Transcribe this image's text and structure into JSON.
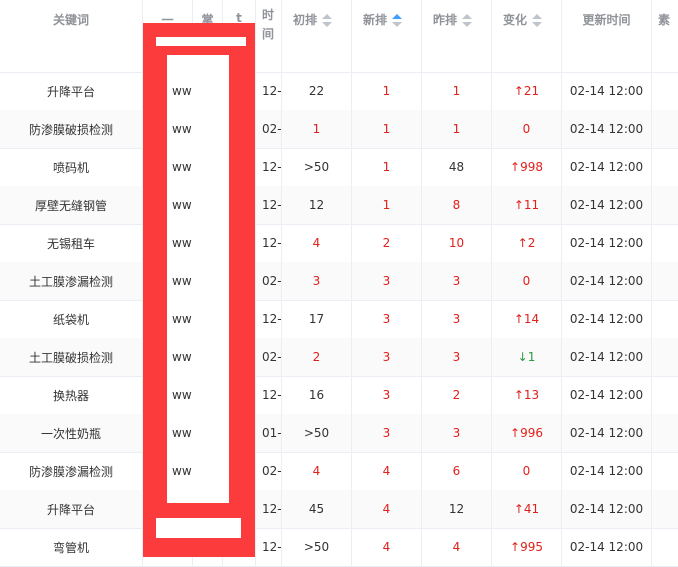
{
  "headers": {
    "keyword": "关键词",
    "col_partial_1": "一",
    "col_partial_2": "掌",
    "col_partial_3": "t",
    "time_chars": [
      "时",
      "间"
    ],
    "initial_rank": "初排",
    "new_rank": "新排",
    "yesterday_rank": "昨排",
    "change": "变化",
    "update_time": "更新时间",
    "last_partial": "素"
  },
  "rows": [
    {
      "keyword": "升降平台",
      "domain": "ww",
      "time": "12-",
      "initial": "22",
      "initial_red": false,
      "new": "1",
      "yesterday": "1",
      "yesterday_red": true,
      "change": "↑21",
      "change_dir": "up",
      "update": "02-14 12:00"
    },
    {
      "keyword": "防渗膜破损检测",
      "domain": "ww",
      "time": "02-",
      "initial": "1",
      "initial_red": true,
      "new": "1",
      "yesterday": "1",
      "yesterday_red": true,
      "change": "0",
      "change_dir": "zero",
      "update": "02-14 12:00"
    },
    {
      "keyword": "喷码机",
      "domain": "ww",
      "time": "12-",
      "initial": ">50",
      "initial_red": false,
      "new": "1",
      "yesterday": "48",
      "yesterday_red": false,
      "change": "↑998",
      "change_dir": "up",
      "update": "02-14 12:00"
    },
    {
      "keyword": "厚壁无缝钢管",
      "domain": "ww",
      "time": "12-",
      "initial": "12",
      "initial_red": false,
      "new": "1",
      "yesterday": "8",
      "yesterday_red": true,
      "change": "↑11",
      "change_dir": "up",
      "update": "02-14 12:00"
    },
    {
      "keyword": "无锡租车",
      "domain": "ww",
      "time": "12-",
      "initial": "4",
      "initial_red": true,
      "new": "2",
      "yesterday": "10",
      "yesterday_red": true,
      "change": "↑2",
      "change_dir": "up",
      "update": "02-14 12:00"
    },
    {
      "keyword": "土工膜渗漏检测",
      "domain": "ww",
      "time": "02-",
      "initial": "3",
      "initial_red": true,
      "new": "3",
      "yesterday": "3",
      "yesterday_red": true,
      "change": "0",
      "change_dir": "zero",
      "update": "02-14 12:00"
    },
    {
      "keyword": "纸袋机",
      "domain": "ww",
      "time": "12-",
      "initial": "17",
      "initial_red": false,
      "new": "3",
      "yesterday": "3",
      "yesterday_red": true,
      "change": "↑14",
      "change_dir": "up",
      "update": "02-14 12:00"
    },
    {
      "keyword": "土工膜破损检测",
      "domain": "ww",
      "time": "02-",
      "initial": "2",
      "initial_red": true,
      "new": "3",
      "yesterday": "3",
      "yesterday_red": true,
      "change": "↓1",
      "change_dir": "down",
      "update": "02-14 12:00"
    },
    {
      "keyword": "换热器",
      "domain": "ww",
      "time": "12-",
      "initial": "16",
      "initial_red": false,
      "new": "3",
      "yesterday": "2",
      "yesterday_red": true,
      "change": "↑13",
      "change_dir": "up",
      "update": "02-14 12:00"
    },
    {
      "keyword": "一次性奶瓶",
      "domain": "ww",
      "time": "01-",
      "initial": ">50",
      "initial_red": false,
      "new": "3",
      "yesterday": "3",
      "yesterday_red": true,
      "change": "↑996",
      "change_dir": "up",
      "update": "02-14 12:00"
    },
    {
      "keyword": "防渗膜渗漏检测",
      "domain": "ww",
      "time": "02-",
      "initial": "4",
      "initial_red": true,
      "new": "4",
      "yesterday": "6",
      "yesterday_red": true,
      "change": "0",
      "change_dir": "zero",
      "update": "02-14 12:00"
    },
    {
      "keyword": "升降平台",
      "domain": "ww",
      "time": "12-",
      "initial": "45",
      "initial_red": false,
      "new": "4",
      "yesterday": "12",
      "yesterday_red": false,
      "change": "↑41",
      "change_dir": "up",
      "update": "02-14 12:00"
    },
    {
      "keyword": "弯管机",
      "domain": "ww",
      "time": "12-",
      "initial": ">50",
      "initial_red": false,
      "new": "4",
      "yesterday": "4",
      "yesterday_red": true,
      "change": "↑995",
      "change_dir": "up",
      "update": "02-14 12:00"
    }
  ],
  "colors": {
    "red": "#e0201b",
    "green": "#2b9a3a",
    "sort_active": "#409eff",
    "redaction": "#fc3c3c"
  }
}
